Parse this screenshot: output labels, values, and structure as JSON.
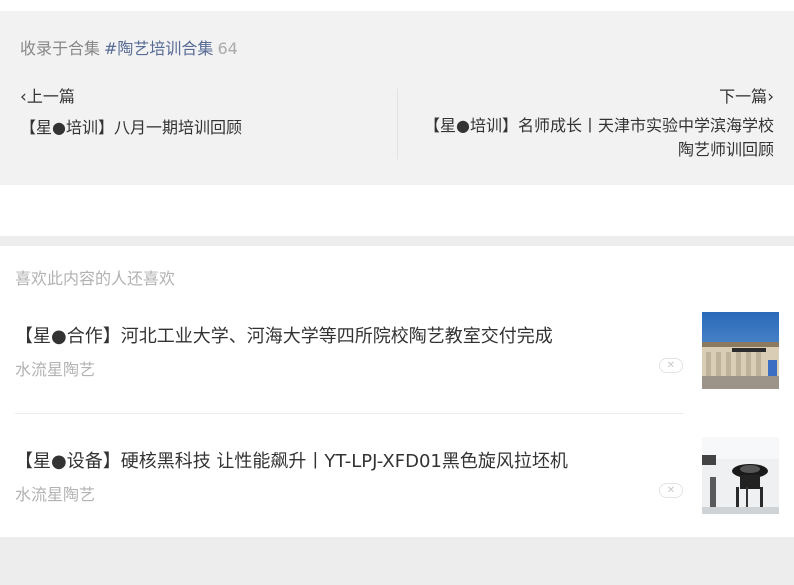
{
  "collection": {
    "prefix": "收录于合集",
    "tag": "#陶艺培训合集",
    "count": "64"
  },
  "nav": {
    "prev_label": "上一篇",
    "prev_title": "【星●培训】八月一期培训回顾",
    "next_label": "下一篇",
    "next_title": "【星●培训】名师成长丨天津市实验中学滨海学校陶艺师训回顾"
  },
  "recommendations": {
    "heading": "喜欢此内容的人还喜欢",
    "items": [
      {
        "title": "【星●合作】河北工业大学、河海大学等四所院校陶艺教室交付完成",
        "source": "水流星陶艺",
        "dismiss": "✕",
        "thumb_icon": "campus-photo-thumbnail"
      },
      {
        "title": "【星●设备】硬核黑科技 让性能飙升丨YT-LPJ-XFD01黑色旋风拉坯机",
        "source": "水流星陶艺",
        "dismiss": "✕",
        "thumb_icon": "pottery-wheel-photo-thumbnail"
      }
    ]
  },
  "icons": {
    "prev": "chevron-left-icon",
    "next": "chevron-right-icon"
  },
  "colors": {
    "link": "#576b95",
    "muted": "#b2b2b2",
    "panel": "#f2f2f2"
  }
}
